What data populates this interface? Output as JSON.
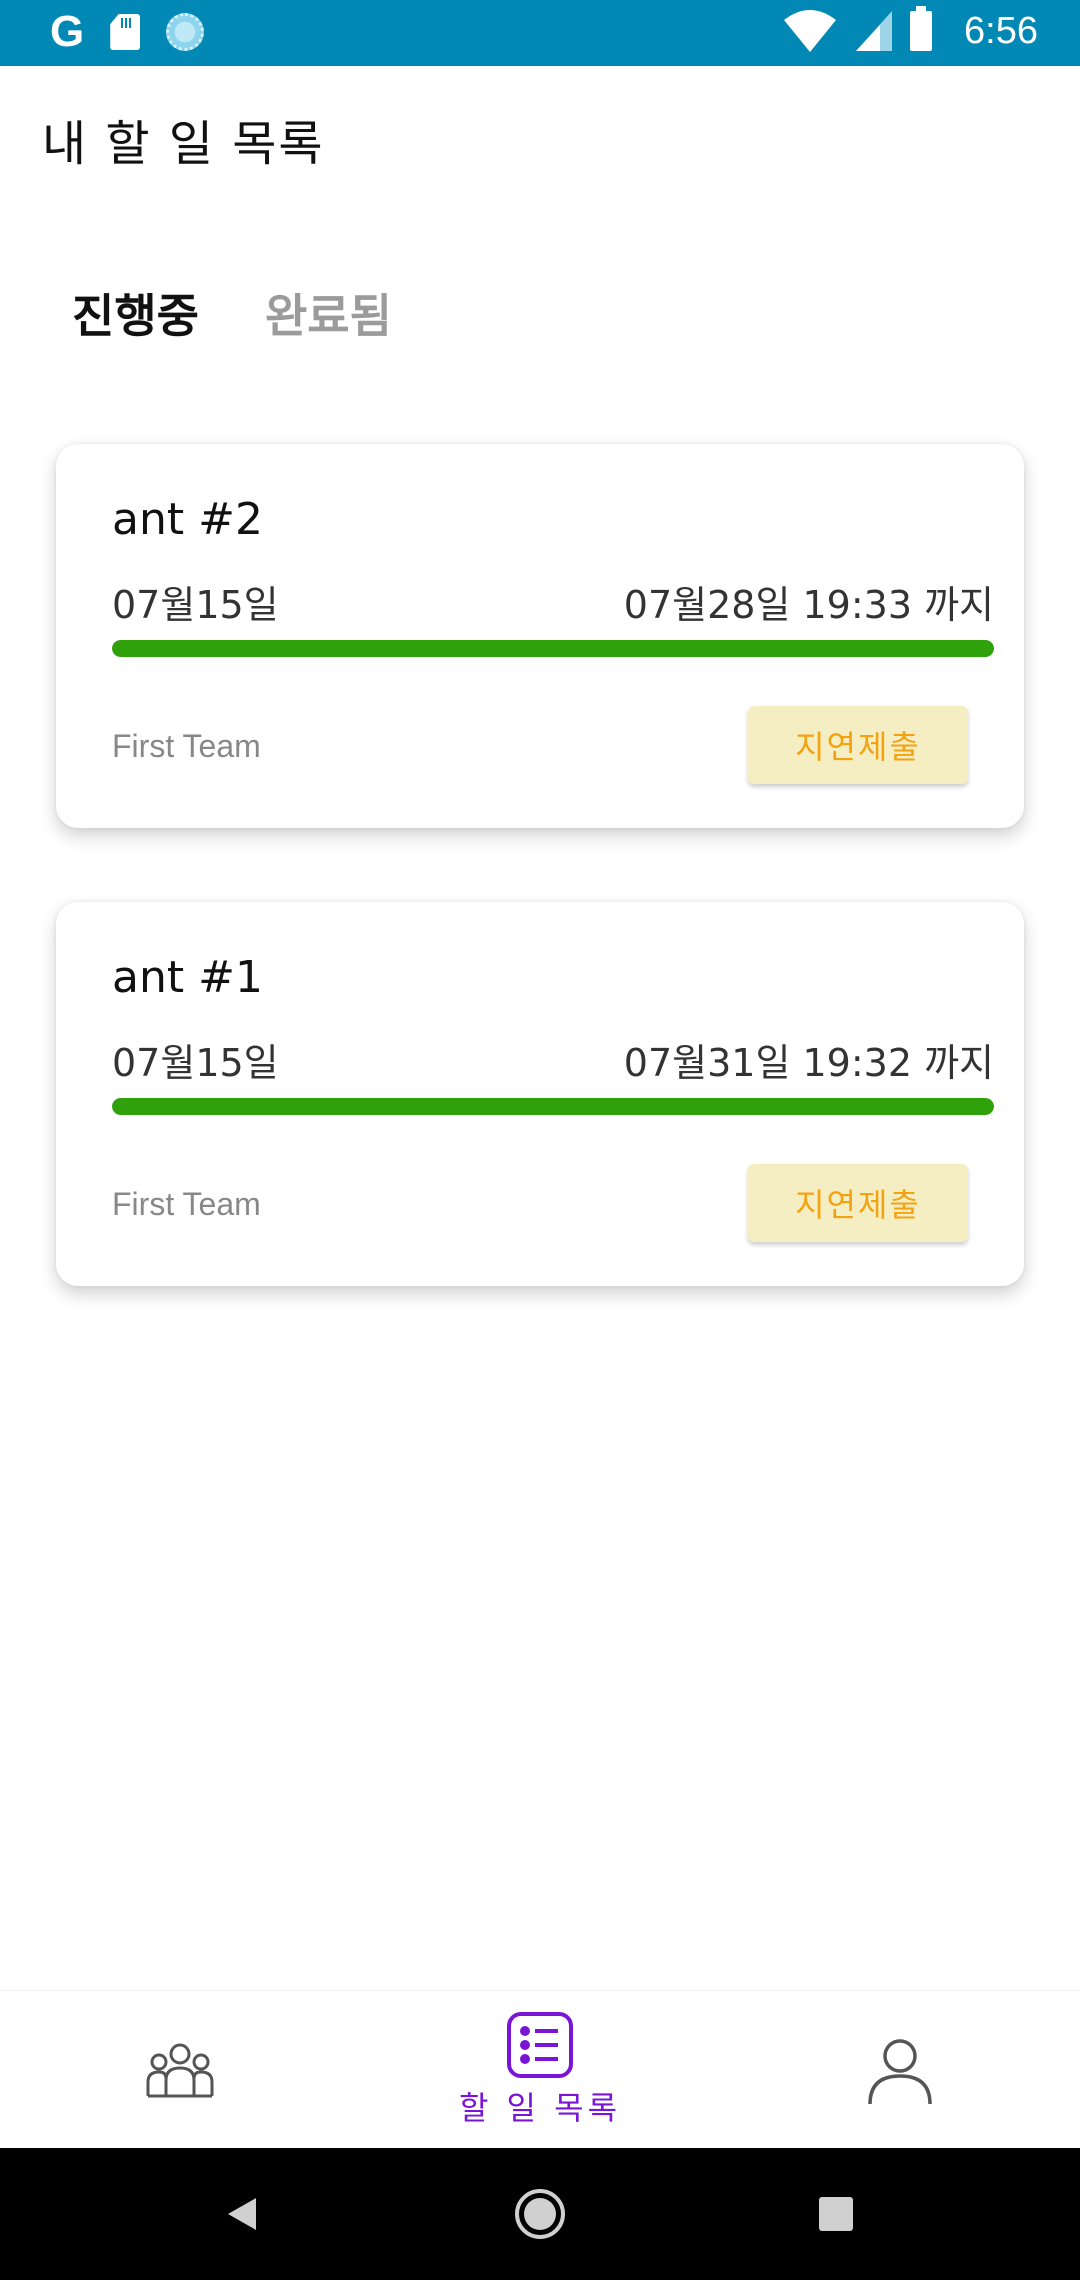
{
  "status_bar": {
    "g_letter": "G",
    "time": "6:56",
    "icons": [
      "google-icon",
      "sd-card-icon",
      "sync-icon",
      "wifi-icon",
      "signal-icon",
      "battery-icon"
    ]
  },
  "header": {
    "title": "내 할 일 목록"
  },
  "tabs": [
    {
      "label": "진행중",
      "selected": true
    },
    {
      "label": "완료됨",
      "selected": false
    }
  ],
  "tasks": [
    {
      "title": "ant #2",
      "start": "07월15일",
      "due": "07월28일 19:33 까지",
      "progress": 1.0,
      "team": "First Team",
      "status_button": "지연제출"
    },
    {
      "title": "ant #1",
      "start": "07월15일",
      "due": "07월31일 19:32 까지",
      "progress": 1.0,
      "team": "First Team",
      "status_button": "지연제출"
    }
  ],
  "bottom_nav": {
    "items": [
      {
        "icon": "team-icon",
        "label": ""
      },
      {
        "icon": "todo-list-icon",
        "label": "할 일 목록",
        "active": true
      },
      {
        "icon": "profile-icon",
        "label": ""
      }
    ]
  },
  "colors": {
    "status_bar": "#0288b4",
    "progress": "#2fa10b",
    "accent": "#7a15d6",
    "late_bg": "#f6eec3",
    "late_text": "#f3a312"
  }
}
